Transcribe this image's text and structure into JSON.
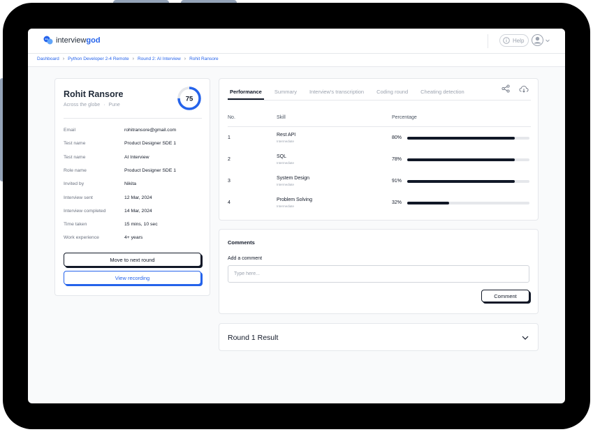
{
  "app": {
    "logo_text": "interviewgod",
    "logo_prefix": "interview",
    "logo_suffix": "god",
    "help_label": "Help"
  },
  "breadcrumb": [
    "Dashboard",
    "Python Developer 2-4 Remote",
    "Round 2: AI Interview",
    "Rohit Ransore"
  ],
  "candidate": {
    "name": "Rohit Ransore",
    "location_primary": "Across the globe",
    "location_separator": "·",
    "location_secondary": "Pune",
    "score": "75",
    "score_fraction": 0.75,
    "details": [
      {
        "label": "Email",
        "value": "rohitransore@gmail.com"
      },
      {
        "label": "Test name",
        "value": "Product Designer SDE 1"
      },
      {
        "label": "Test name",
        "value": "AI Interview"
      },
      {
        "label": "Role name",
        "value": "Product Designer SDE 1"
      },
      {
        "label": "Invited by",
        "value": "Nikita"
      },
      {
        "label": "Interview sent",
        "value": "12 Mar, 2024"
      },
      {
        "label": "Interview completed",
        "value": "14 Mar, 2024"
      },
      {
        "label": "Time taken",
        "value": "15 mins, 10 sec"
      },
      {
        "label": "Work experience",
        "value": "4+ years"
      }
    ],
    "next_round_label": "Move to next round",
    "view_recording_label": "View recording"
  },
  "tabs": [
    "Performance",
    "Summary",
    "Interview's transcription",
    "Coding round",
    "Cheating detection"
  ],
  "active_tab": "Performance",
  "performance": {
    "headers": {
      "no": "No.",
      "skill": "Skill",
      "percentage": "Percentage"
    },
    "rows": [
      {
        "no": "1",
        "skill": "Rest API",
        "level": "Intermediate",
        "percent_label": "80%",
        "bar_fraction": 0.88
      },
      {
        "no": "2",
        "skill": "SQL",
        "level": "Intermediate",
        "percent_label": "78%",
        "bar_fraction": 0.88
      },
      {
        "no": "3",
        "skill": "System Design",
        "level": "Intermediate",
        "percent_label": "91%",
        "bar_fraction": 0.88
      },
      {
        "no": "4",
        "skill": "Problem Solving",
        "level": "Intermediate",
        "percent_label": "32%",
        "bar_fraction": 0.34
      }
    ]
  },
  "comments": {
    "title": "Comments",
    "add_label": "Add a comment",
    "placeholder": "Type here...",
    "submit_label": "Comment"
  },
  "round1": {
    "title": "Round 1 Result"
  },
  "colors": {
    "accent": "#2563eb",
    "dark": "#111827",
    "score_ring": "#2563eb"
  },
  "icons": [
    "logo-chat-icon",
    "info-icon",
    "user-avatar-icon",
    "chevron-down-icon",
    "chevron-right-icon",
    "share-icon",
    "cloud-download-icon"
  ]
}
